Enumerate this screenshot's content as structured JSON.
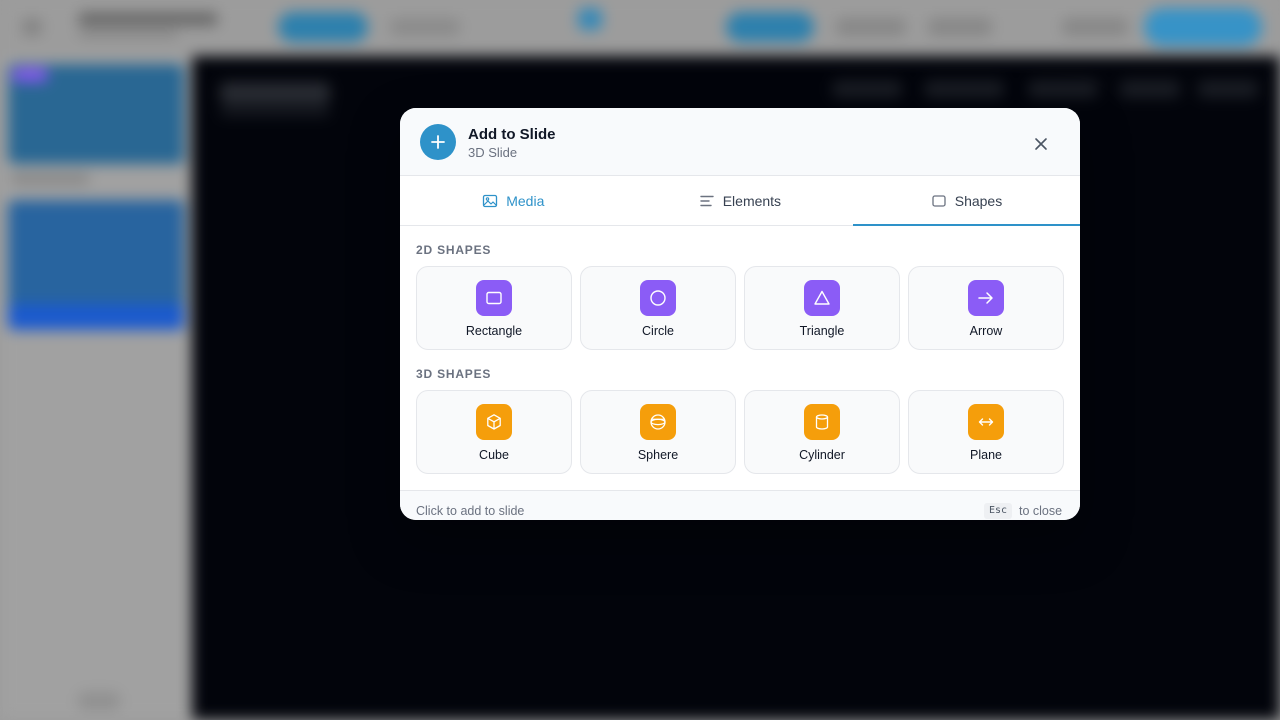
{
  "modal": {
    "title": "Add to Slide",
    "subtitle": "3D Slide",
    "tabs": [
      {
        "label": "Media",
        "icon": "image-icon",
        "active": false
      },
      {
        "label": "Elements",
        "icon": "text-lines-icon",
        "active": false
      },
      {
        "label": "Shapes",
        "icon": "square-icon",
        "active": true
      }
    ],
    "sections": [
      {
        "label": "2D SHAPES",
        "items": [
          {
            "label": "Rectangle",
            "icon": "rectangle-icon"
          },
          {
            "label": "Circle",
            "icon": "circle-icon"
          },
          {
            "label": "Triangle",
            "icon": "triangle-icon"
          },
          {
            "label": "Arrow",
            "icon": "arrow-right-icon"
          }
        ]
      },
      {
        "label": "3D SHAPES",
        "items": [
          {
            "label": "Cube",
            "icon": "cube-icon"
          },
          {
            "label": "Sphere",
            "icon": "sphere-icon"
          },
          {
            "label": "Cylinder",
            "icon": "cylinder-icon"
          },
          {
            "label": "Plane",
            "icon": "plane-arrows-icon"
          }
        ]
      }
    ],
    "footer": {
      "hint": "Click to add to slide",
      "key": "Esc",
      "key_action": "to close"
    }
  },
  "colors": {
    "accent": "#2e92c9",
    "shape_2d": "#8b5cf6",
    "shape_3d": "#f59e0b",
    "canvas": "#03050c"
  }
}
